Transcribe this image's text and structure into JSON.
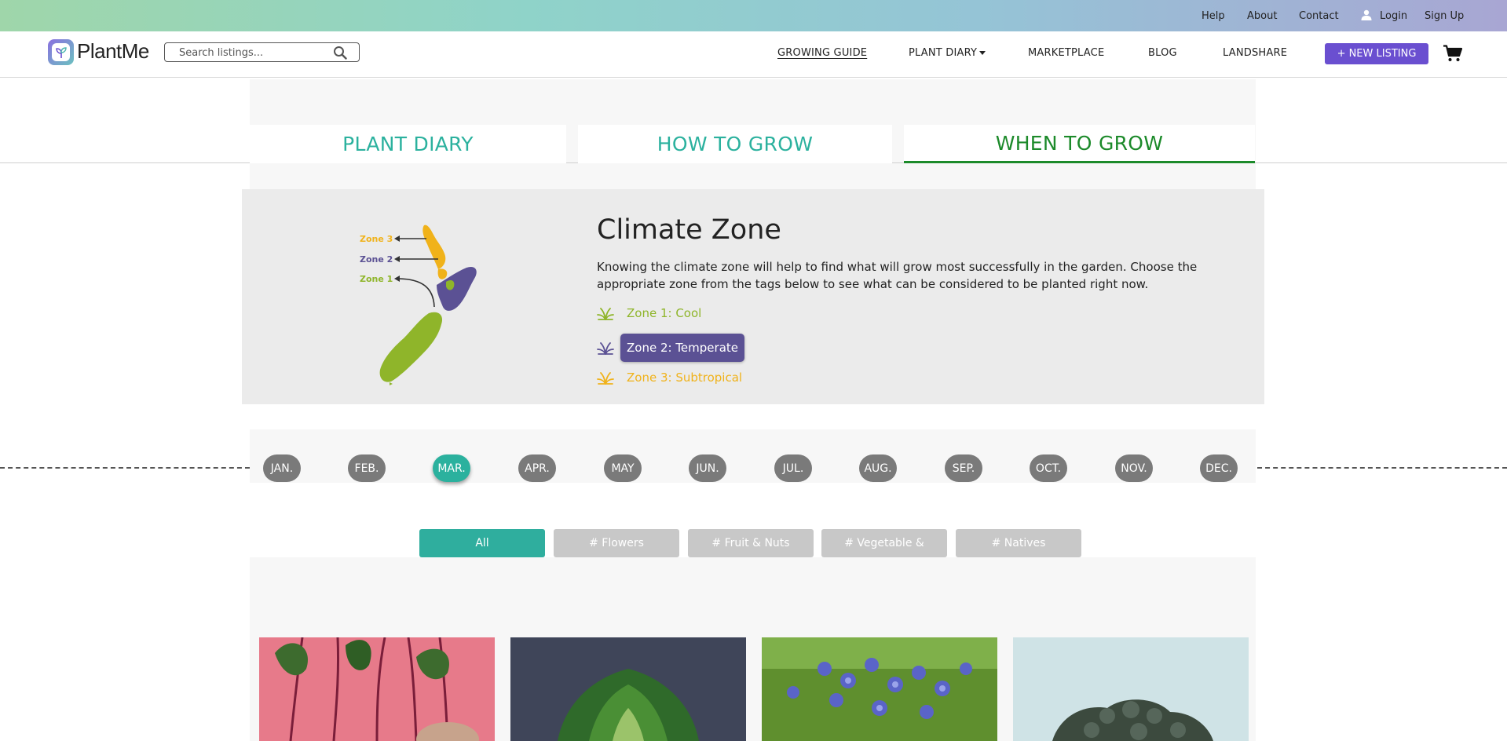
{
  "topbar": {
    "help": "Help",
    "about": "About",
    "contact": "Contact",
    "login": "Login",
    "signup": "Sign Up"
  },
  "nav": {
    "logo_text": "PlantMe",
    "search_placeholder": "Search listings...",
    "growing_guide": "GROWING GUIDE",
    "plant_diary": "PLANT DIARY",
    "marketplace": "MARKETPLACE",
    "blog": "BLOG",
    "landshare": "LANDSHARE",
    "new_listing": "+ NEW LISTING"
  },
  "tabs": [
    {
      "label": "PLANT DIARY",
      "active": false
    },
    {
      "label": "HOW TO GROW",
      "active": false
    },
    {
      "label": "WHEN TO GROW",
      "active": true
    }
  ],
  "climate": {
    "title": "Climate Zone",
    "description": "Knowing the climate zone will help to find what will grow most successfully in the garden. Choose the appropriate zone from the tags below to see what can be considered to be planted right now.",
    "map_labels": [
      "Zone 3",
      "Zone 2",
      "Zone 1"
    ],
    "zones": [
      {
        "label": "Zone 1: Cool",
        "color": "#8fb52a",
        "selected": false
      },
      {
        "label": "Zone 2: Temperate",
        "color": "#5b5194",
        "selected": true
      },
      {
        "label": "Zone 3: Subtropical",
        "color": "#f0b21a",
        "selected": false
      }
    ]
  },
  "months": [
    "JAN.",
    "FEB.",
    "MAR.",
    "APR.",
    "MAY",
    "JUN.",
    "JUL.",
    "AUG.",
    "SEP.",
    "OCT.",
    "NOV.",
    "DEC."
  ],
  "selected_month": "MAR.",
  "filters": [
    {
      "label": "All",
      "selected": true
    },
    {
      "label": "# Flowers",
      "selected": false
    },
    {
      "label": "# Fruit & Nuts",
      "selected": false
    },
    {
      "label": "# Vegetable &",
      "selected": false
    },
    {
      "label": "# Natives",
      "selected": false
    }
  ],
  "cards": [
    {
      "image": "beetroot-photo"
    },
    {
      "image": "bok-choy-photo"
    },
    {
      "image": "borage-flowers-photo"
    },
    {
      "image": "broccoli-photo"
    }
  ],
  "colors": {
    "accent_teal": "#2bb19e",
    "active_green": "#1c8a2a",
    "brand_purple": "#6a4fd0",
    "zone_cool": "#8fb52a",
    "zone_temperate": "#5b5194",
    "zone_subtropical": "#f0b21a"
  }
}
